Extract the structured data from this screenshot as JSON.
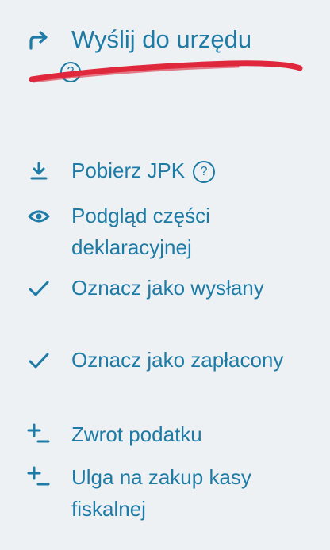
{
  "primary_action": {
    "label": "Wyślij do urzędu",
    "icon": "forward-arrow-icon",
    "help_glyph": "?"
  },
  "menu_items": [
    {
      "label": "Pobierz JPK",
      "icon": "download-icon",
      "help_glyph": "?"
    },
    {
      "label": "Podgląd części deklaracyjnej",
      "icon": "eye-icon"
    },
    {
      "label": "Oznacz jako wysłany",
      "icon": "check-icon"
    },
    {
      "label": "Oznacz jako zapłacony",
      "icon": "check-icon"
    },
    {
      "label": "Zwrot podatku",
      "icon": "plus-minus-icon"
    },
    {
      "label": "Ulga na zakup kasy fiskalnej",
      "icon": "plus-minus-icon"
    }
  ],
  "colors": {
    "accent": "#1e7ba6",
    "background": "#edf1f4",
    "annotation": "#e0283c"
  }
}
